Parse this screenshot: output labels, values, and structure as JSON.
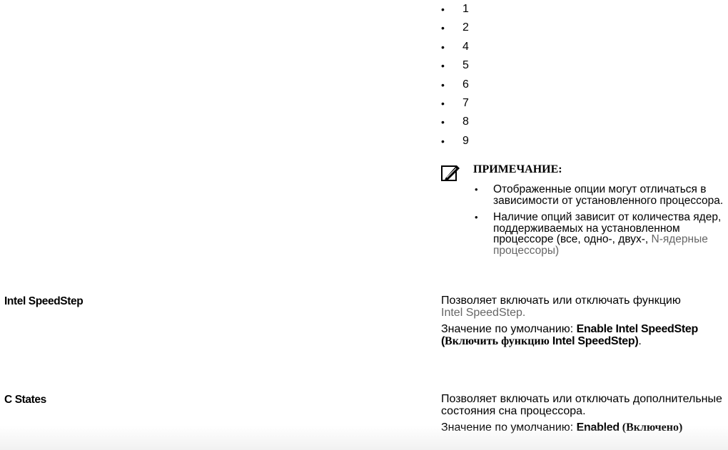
{
  "options_list": [
    "1",
    "2",
    "4",
    "5",
    "6",
    "7",
    "8",
    "9"
  ],
  "bullet": "•",
  "note": {
    "icon": "pencil-note-icon",
    "title": "ПРИМЕЧАНИЕ:",
    "item1": "Отображенные опции могут отличаться в зависимости от установленного процессора.",
    "item2_a": "Наличие опций зависит от количества ядер, поддерживаемых на установленном процессоре (все, одно-, двух-,",
    "item2_b": "N-ядерные процессоры)"
  },
  "speedstep": {
    "label": "Intel SpeedStep",
    "desc_a": "Позволяет включать или отключать функцию",
    "desc_b": "Intel SpeedStep.",
    "default_prefix": "Значение по умолчанию: ",
    "default_value": "Enable Intel SpeedStep",
    "default_open": " (",
    "default_ru": "Включить функцию ",
    "default_ru_brand": "Intel SpeedStep",
    "default_close": ")",
    "default_end": "."
  },
  "cstates": {
    "label": "C States",
    "desc": "Позволяет включать или отключать дополнительные состояния сна процессора.",
    "default_prefix": "Значение по умолчанию: ",
    "default_value": "Enabled",
    "default_ru": " (Включено)"
  }
}
